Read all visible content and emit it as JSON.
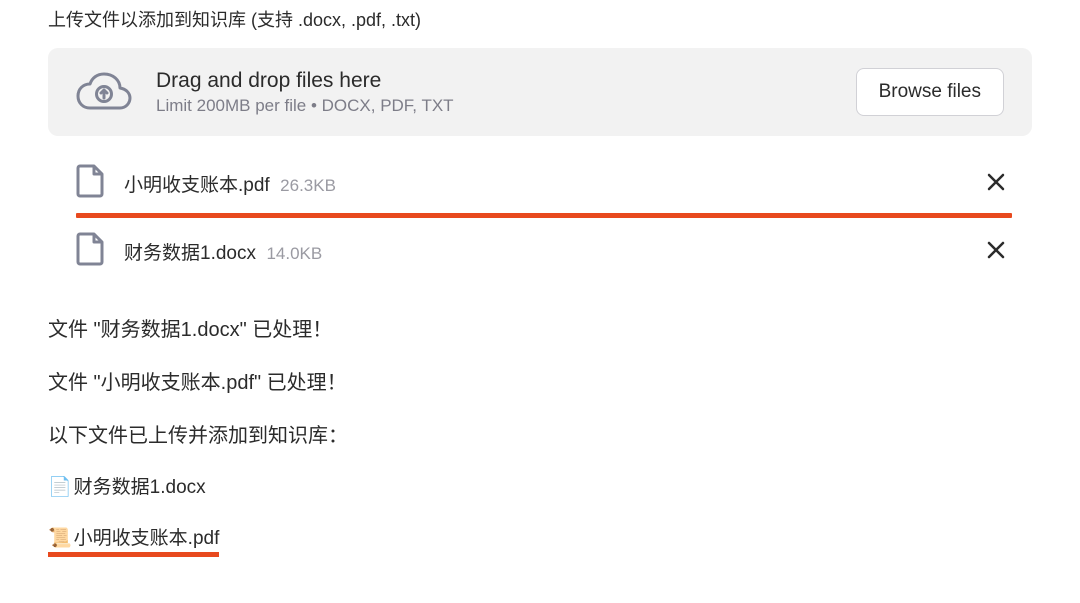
{
  "instruction": "上传文件以添加到知识库 (支持 .docx, .pdf, .txt)",
  "dropzone": {
    "title": "Drag and drop files here",
    "limit": "Limit 200MB per file • DOCX, PDF, TXT",
    "browse_label": "Browse files"
  },
  "files": [
    {
      "name": "小明收支账本.pdf",
      "size": "26.3KB"
    },
    {
      "name": "财务数据1.docx",
      "size": "14.0KB"
    }
  ],
  "status": {
    "processed": [
      "文件 \"财务数据1.docx\" 已处理！",
      "文件 \"小明收支账本.pdf\" 已处理！"
    ],
    "summary": "以下文件已上传并添加到知识库："
  },
  "kb_files": [
    {
      "emoji": "📄",
      "name": "财务数据1.docx"
    },
    {
      "emoji": "📜",
      "name": "小明收支账本.pdf"
    }
  ]
}
